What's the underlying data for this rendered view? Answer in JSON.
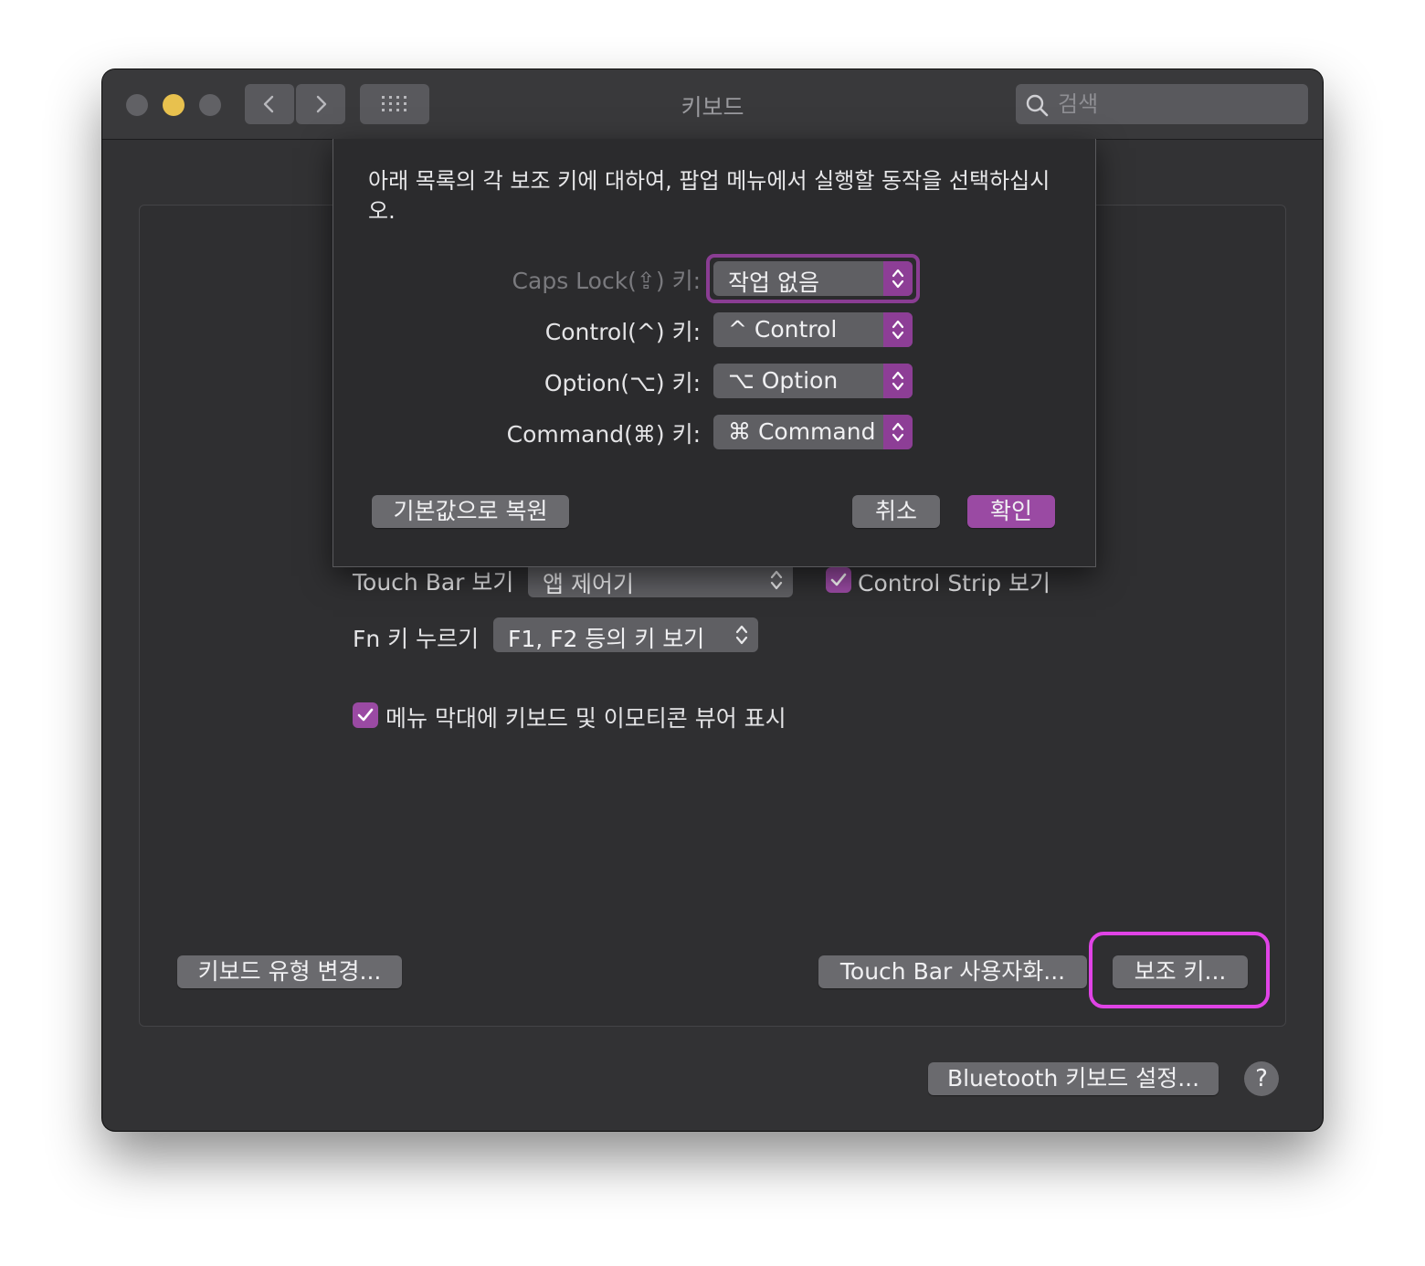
{
  "window": {
    "title": "키보드",
    "search_placeholder": "검색"
  },
  "panel": {
    "touchbar_label": "Touch Bar 보기",
    "touchbar_value": "앱 제어기",
    "control_strip_label": "Control Strip 보기",
    "fn_label": "Fn 키 누르기",
    "fn_value": "F1, F2 등의 키 보기",
    "emoji_viewer_label": "메뉴 막대에 키보드 및 이모티콘 뷰어 표시",
    "change_type_button": "키보드 유형 변경...",
    "customize_touchbar_button": "Touch Bar 사용자화...",
    "modifier_keys_button": "보조 키..."
  },
  "footer": {
    "bluetooth_button": "Bluetooth 키보드 설정...",
    "help_button": "?"
  },
  "sheet": {
    "description": "아래 목록의 각 보조 키에 대하여, 팝업 메뉴에서 실행할 동작을 선택하십시오.",
    "rows": [
      {
        "label": "Caps Lock(⇪) 키:",
        "value": "작업 없음"
      },
      {
        "label": "Control(^) 키:",
        "value": "^ Control"
      },
      {
        "label": "Option(⌥) 키:",
        "value": "⌥ Option"
      },
      {
        "label": "Command(⌘) 키:",
        "value": "⌘ Command"
      }
    ],
    "restore_defaults_button": "기본값으로 복원",
    "cancel_button": "취소",
    "ok_button": "확인"
  },
  "colors": {
    "accent": "#9a4aa3",
    "highlight": "#e043e6",
    "window_bg": "#323234"
  }
}
